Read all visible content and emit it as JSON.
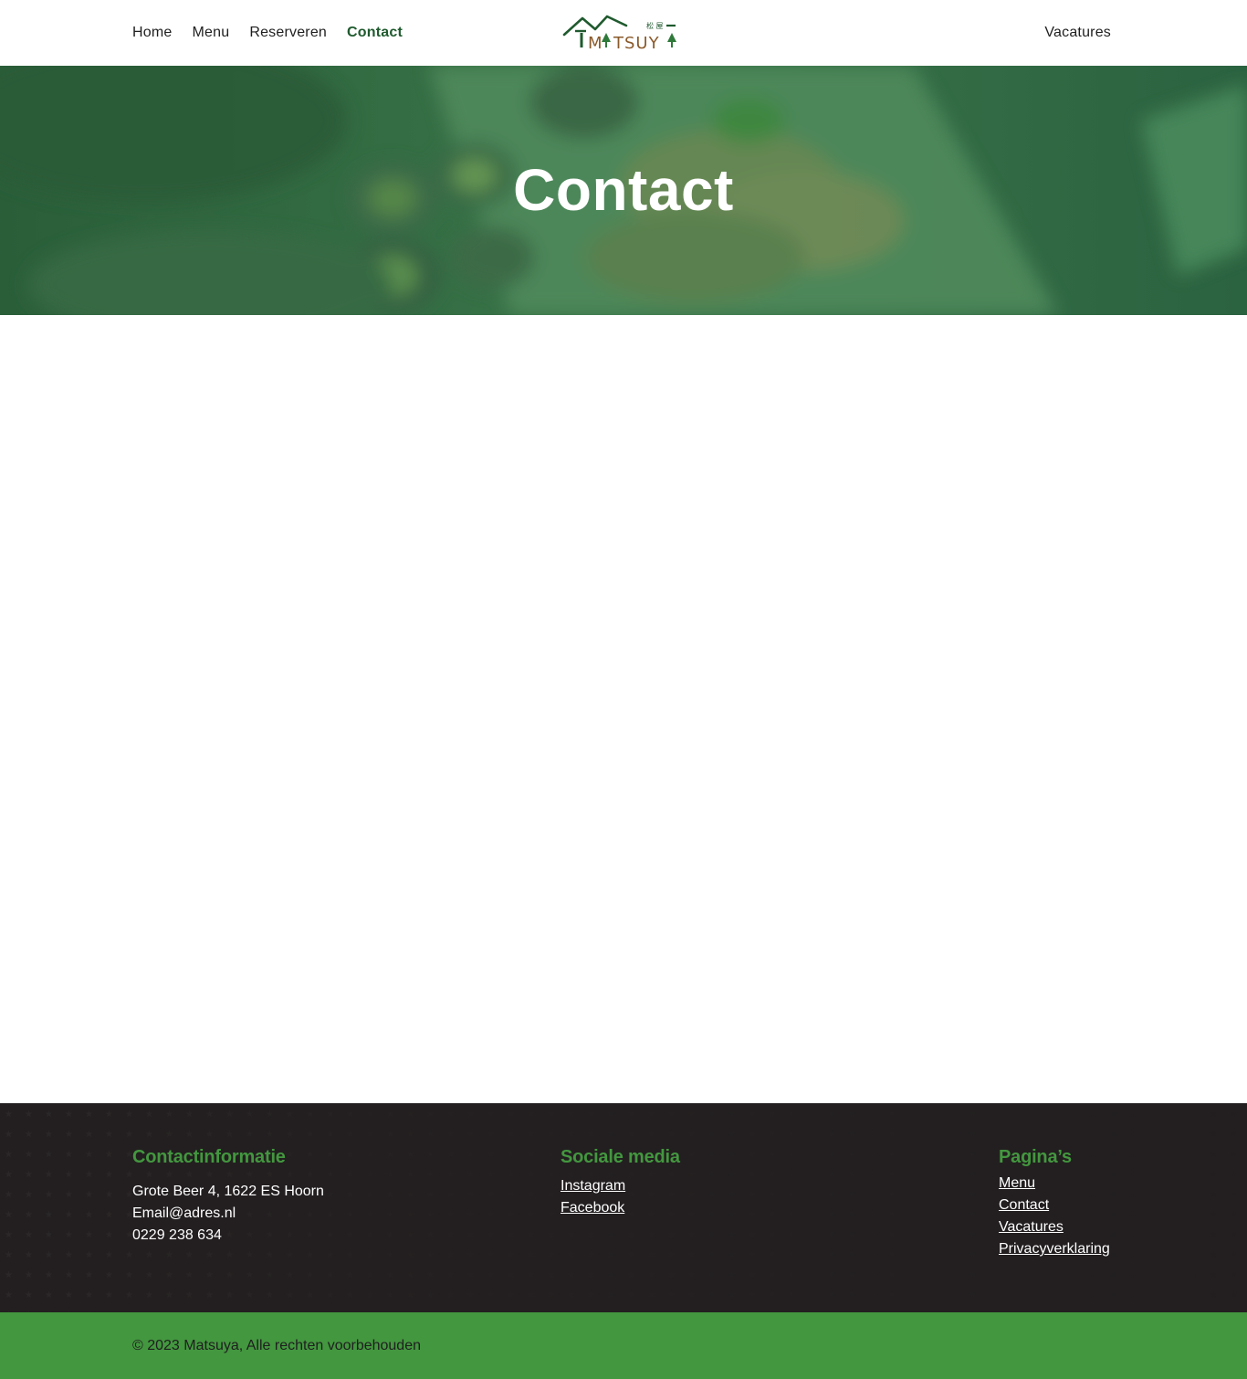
{
  "nav": {
    "items": [
      {
        "label": "Home",
        "active": false
      },
      {
        "label": "Menu",
        "active": false
      },
      {
        "label": "Reserveren",
        "active": false
      },
      {
        "label": "Contact",
        "active": true
      }
    ],
    "right_label": "Vacatures"
  },
  "logo": {
    "text": "MATSUYA",
    "kanji": "松 屋"
  },
  "hero": {
    "title": "Contact"
  },
  "footer": {
    "contact": {
      "heading": "Contactinformatie",
      "address": "Grote Beer 4, 1622 ES Hoorn",
      "email": "Email@adres.nl",
      "phone": "0229 238 634"
    },
    "social": {
      "heading": "Sociale media",
      "links": [
        "Instagram",
        "Facebook"
      ]
    },
    "pages": {
      "heading": "Pagina’s",
      "links": [
        "Menu",
        "Contact",
        "Vacatures",
        "Privacyverklaring"
      ]
    },
    "copyright": "© 2023 Matsuya, Alle rechten voorbehouden"
  },
  "colors": {
    "brand_green": "#43973f",
    "dark_green": "#1f5a2e",
    "footer_bg": "#231f20",
    "hero_overlay": "#2f6a40"
  }
}
